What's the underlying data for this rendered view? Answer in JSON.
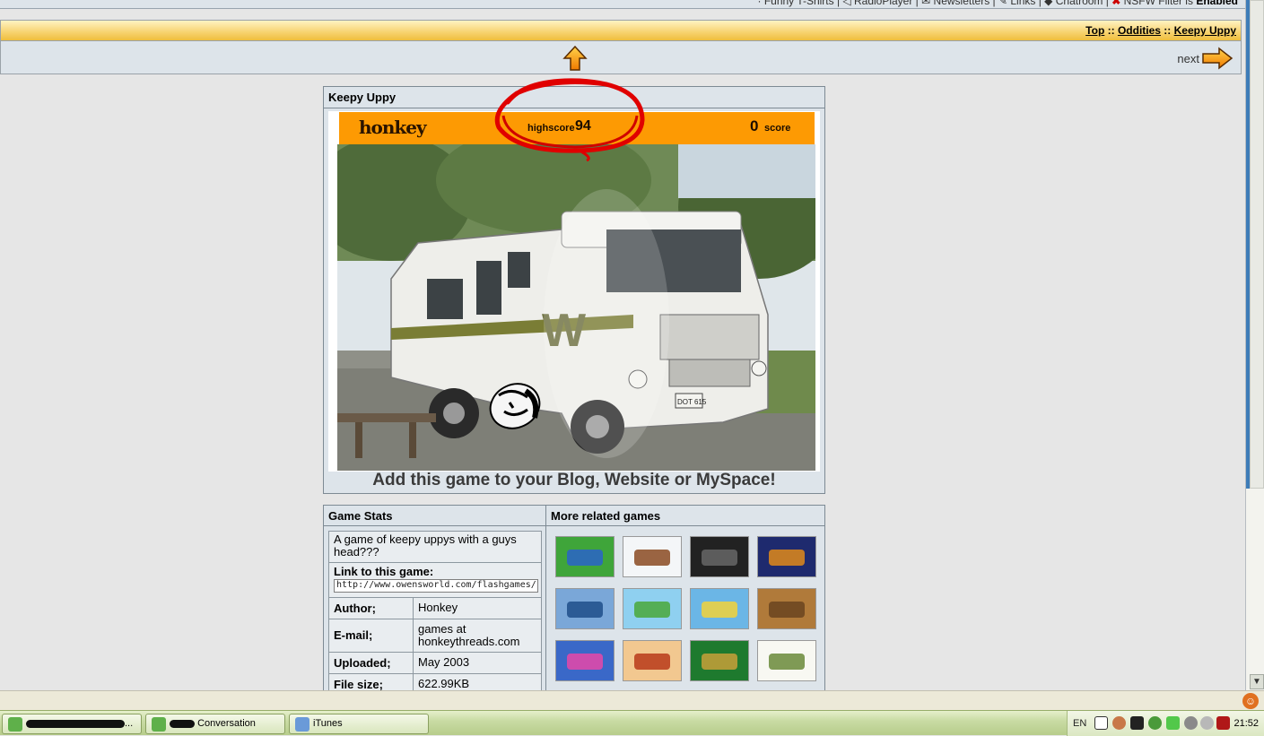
{
  "top_links": {
    "text": "· Funny T-Shirts | ◁ RadioPlayer | ✉ Newsletters | ✎ Links | ◆ Chatroom |",
    "nsfw_prefix": "NSFW Filter is",
    "nsfw_state": "Enabled"
  },
  "breadcrumb": {
    "top": "Top",
    "sep1": " :: ",
    "cat": "Oddities",
    "sep2": " :: ",
    "current": "Keepy Uppy"
  },
  "nav": {
    "next_label": "next"
  },
  "game": {
    "title": "Keepy Uppy",
    "logo": "honkey",
    "highscore_label": "highscore",
    "highscore_value": "94",
    "score_value": "0",
    "score_label": "score",
    "plate": "DOT 615",
    "embed_text": "Add this game to your Blog, Website or MySpace!"
  },
  "stats": {
    "heading": "Game Stats",
    "description": "A game of keepy uppys with a guys head???",
    "link_label": "Link to this game:",
    "link_value": "http://www.owensworld.com/flashgames/",
    "author_label": "Author;",
    "author_value": "Honkey",
    "email_label": "E-mail;",
    "email_value": "games at honkeythreads.com",
    "uploaded_label": "Uploaded;",
    "uploaded_value": "May 2003",
    "filesize_label": "File size;",
    "filesize_value": "622.99KB"
  },
  "related": {
    "heading": "More related games",
    "thumbs": [
      {
        "name": "related-game-1",
        "bg": "#3fa53a",
        "fg": "#2a63c9"
      },
      {
        "name": "related-game-2",
        "bg": "#f4f6f8",
        "fg": "#8a4a22"
      },
      {
        "name": "related-game-3",
        "bg": "#222222",
        "fg": "#666666"
      },
      {
        "name": "related-game-4",
        "bg": "#1e2a6e",
        "fg": "#e08a1a"
      },
      {
        "name": "related-game-5",
        "bg": "#7aa7d8",
        "fg": "#1e4e8a"
      },
      {
        "name": "related-game-6",
        "bg": "#8fd0f0",
        "fg": "#4aa83a"
      },
      {
        "name": "related-game-7",
        "bg": "#6bb6e6",
        "fg": "#f2d23a"
      },
      {
        "name": "related-game-8",
        "bg": "#b07a3a",
        "fg": "#6a4420"
      },
      {
        "name": "related-game-9",
        "bg": "#3a68c8",
        "fg": "#e848a8"
      },
      {
        "name": "related-game-10",
        "bg": "#f2c890",
        "fg": "#b83a1a"
      },
      {
        "name": "related-game-11",
        "bg": "#1e7a2e",
        "fg": "#c8a038"
      },
      {
        "name": "related-game-12",
        "bg": "#f8f8f2",
        "fg": "#6a8a3a"
      }
    ]
  },
  "taskbar": {
    "btn1_suffix": "...",
    "btn2_label": "Conversation",
    "btn3_label": "iTunes",
    "lang": "EN",
    "clock": "21:52"
  },
  "colors": {
    "accent_orange": "#fd9a03",
    "breadcrumb_gold": "#f7d26e",
    "panel_bg": "#dde4ea"
  }
}
